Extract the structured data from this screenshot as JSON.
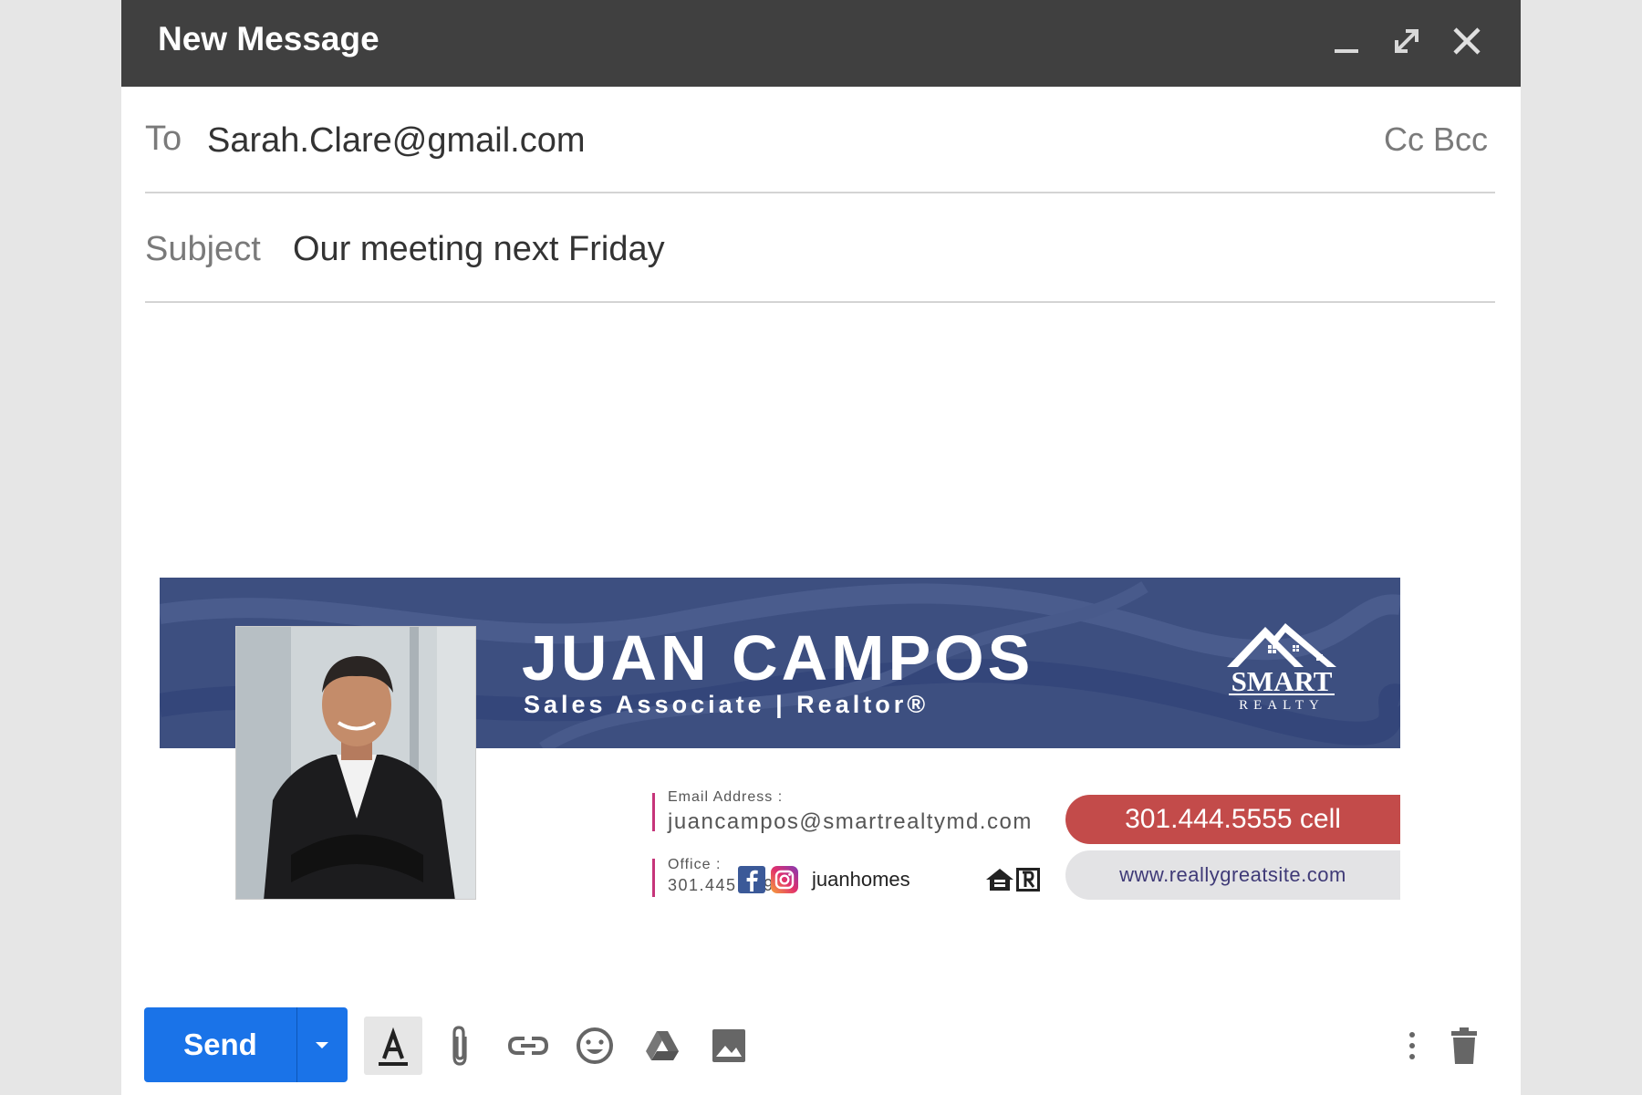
{
  "window": {
    "title": "New Message",
    "controls": [
      "minimize-icon",
      "expand-icon",
      "close-icon"
    ]
  },
  "to": {
    "label": "To",
    "value": "Sarah.Clare@gmail.com",
    "cc_bcc": "Cc Bcc"
  },
  "subject": {
    "label": "Subject",
    "value": "Our meeting next Friday"
  },
  "signature": {
    "name": "JUAN CAMPOS",
    "role": "Sales Associate | Realtor®",
    "logo": {
      "word": "SMART",
      "subword": "REALTY"
    },
    "email_label": "Email Address :",
    "email_value": "juancampos@smartrealtymd.com",
    "office_label": "Office  :",
    "office_value": "301.445.1395",
    "social_handle": "juanhomes",
    "cell": "301.444.5555 cell",
    "website": "www.reallygreatsite.com",
    "colors": {
      "banner": "#3d4f80",
      "cell_pill": "#c34b4a",
      "accent_bar": "#c6357a"
    }
  },
  "toolbar": {
    "send_label": "Send",
    "icons": [
      "formatting-icon",
      "attach-icon",
      "link-icon",
      "emoji-icon",
      "drive-icon",
      "photo-icon",
      "more-options-icon",
      "trash-icon"
    ]
  },
  "colors": {
    "send": "#1a73e8",
    "titlebar": "#404040"
  }
}
